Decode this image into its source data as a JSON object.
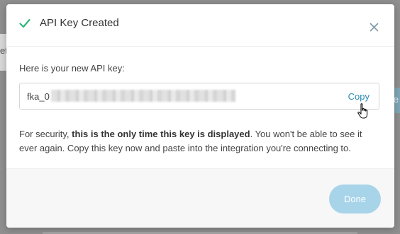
{
  "background": {
    "left_text": "et",
    "right_text": "e"
  },
  "modal": {
    "title": "API Key Created",
    "icons": {
      "title_icon": "check-icon",
      "close_icon": "close-icon"
    },
    "key_label": "Here is your new API key:",
    "key_prefix": "fka_0",
    "copy_label": "Copy",
    "note_pre": "For security, ",
    "note_bold": "this is the only time this key is displayed",
    "note_post": ". You won't be able to see it ever again. Copy this key now and paste into the integration you're connecting to.",
    "done_label": "Done"
  },
  "colors": {
    "accent": "#2a8ab3",
    "check": "#2eb67d",
    "done_button": "#a8d4ea"
  }
}
